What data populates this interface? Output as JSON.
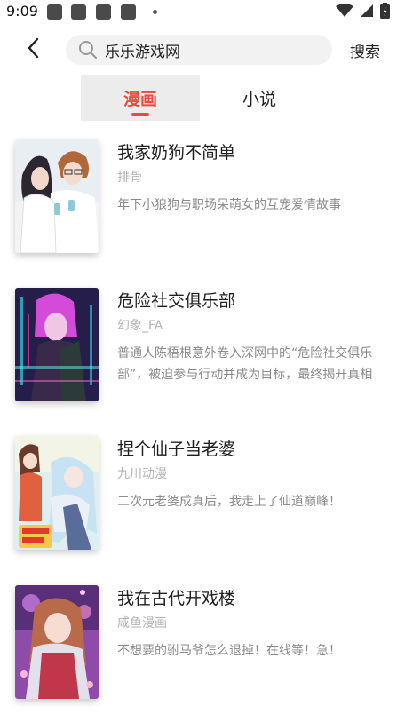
{
  "status_bar": {
    "time": "9:09"
  },
  "header": {
    "back_icon": "chevron-left-icon",
    "search_icon": "search-icon",
    "search_value": "乐乐游戏网",
    "search_button": "搜索"
  },
  "tabs": [
    {
      "label": "漫画",
      "active": true
    },
    {
      "label": "小说",
      "active": false
    }
  ],
  "colors": {
    "accent": "#ea4a3c",
    "tab_active_bg": "#ececec",
    "search_bg": "#f2f2f2",
    "author": "#b3b3b3",
    "desc": "#8a8a8a"
  },
  "comics": [
    {
      "title": "我家奶狗不简单",
      "author": "排骨",
      "desc": "年下小狼狗与职场呆萌女的互宠爱情故事"
    },
    {
      "title": "危险社交俱乐部",
      "author": "幻象_FA",
      "desc": "普通人陈梧根意外卷入深网中的“危险社交俱乐部”，被迫参与行动并成为目标，最终揭开真相"
    },
    {
      "title": "捏个仙子当老婆",
      "author": "九川动漫",
      "desc": "二次元老婆成真后，我走上了仙道巅峰！"
    },
    {
      "title": "我在古代开戏楼",
      "author": "咸鱼漫画",
      "desc": "不想要的驸马爷怎么退掉！在线等！急！"
    }
  ]
}
